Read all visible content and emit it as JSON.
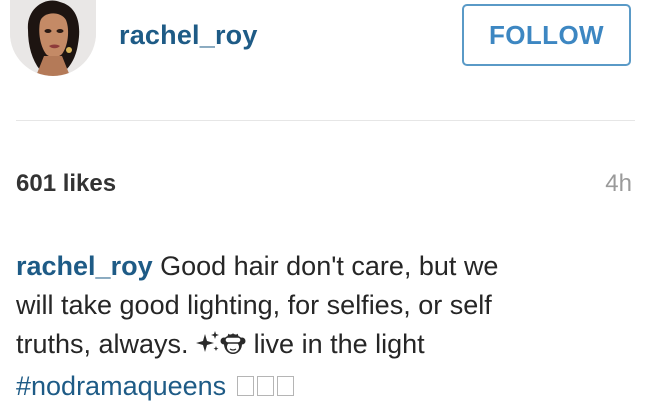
{
  "post": {
    "header": {
      "username": "rachel_roy",
      "follow_label": "FOLLOW",
      "avatar_icon": "profile-photo"
    },
    "stats": {
      "likes": "601 likes",
      "time": "4h"
    },
    "caption": {
      "username": "rachel_roy",
      "line1": " Good hair don't care, but we",
      "line2": "will take good lighting, for selfies, or self",
      "line3_prefix": "truths, always. ",
      "line3_suffix": " live in the light",
      "hashtag": "#nodramaqueens",
      "emoji_icons": [
        "sparkles-icon",
        "see-no-evil-monkey-icon"
      ],
      "unrendered_glyph_count": 3
    },
    "colors": {
      "link": "#1e5b86",
      "button": "#3d87c2",
      "muted": "#9a9a9a"
    }
  }
}
